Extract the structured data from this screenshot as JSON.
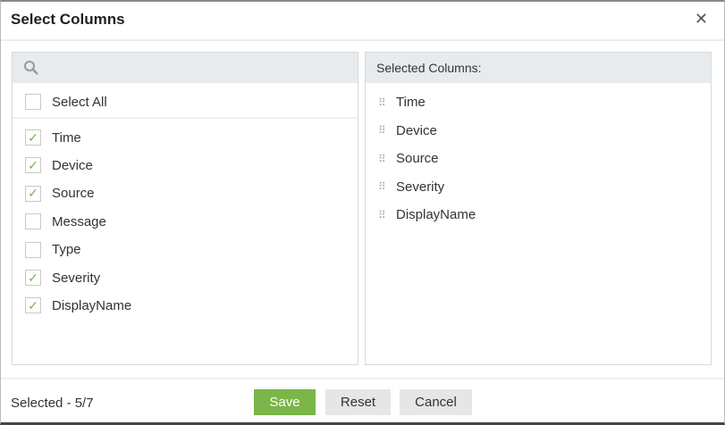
{
  "dialog": {
    "title": "Select Columns",
    "close_icon": "close-icon"
  },
  "left": {
    "search_placeholder": "",
    "select_all": "Select All",
    "items": [
      {
        "label": "Time",
        "checked": true
      },
      {
        "label": "Device",
        "checked": true
      },
      {
        "label": "Source",
        "checked": true
      },
      {
        "label": "Message",
        "checked": false
      },
      {
        "label": "Type",
        "checked": false
      },
      {
        "label": "Severity",
        "checked": true
      },
      {
        "label": "DisplayName",
        "checked": true
      }
    ]
  },
  "right": {
    "header": "Selected Columns:",
    "items": [
      "Time",
      "Device",
      "Source",
      "Severity",
      "DisplayName"
    ]
  },
  "footer": {
    "status": "Selected - 5/7",
    "save": "Save",
    "reset": "Reset",
    "cancel": "Cancel"
  },
  "colors": {
    "accent": "#7ab648",
    "check": "#6dbb45"
  }
}
